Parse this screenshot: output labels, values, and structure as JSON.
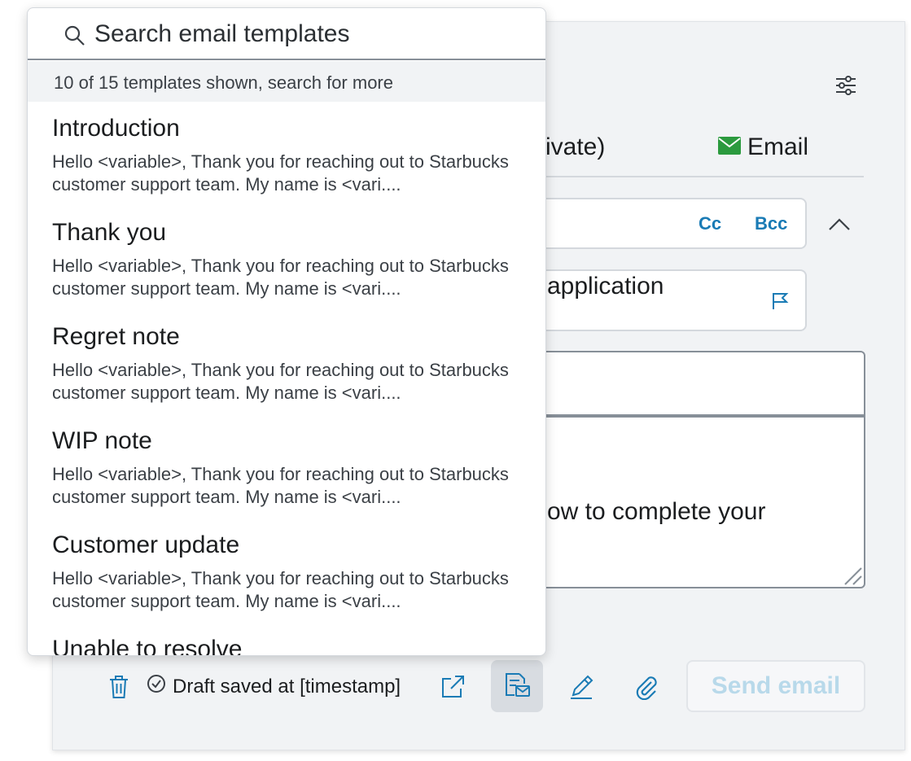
{
  "colors": {
    "accent": "#1a7bb5",
    "email_icon": "#2b9a3e",
    "send_disabled_text": "#b8d9ea"
  },
  "composer": {
    "tabs": {
      "private_fragment": "Private)",
      "email_label": "Email",
      "email_icon": "envelope-icon"
    },
    "recipients": {
      "cc_label": "Cc",
      "bcc_label": "Bcc"
    },
    "subject_fragment": "application",
    "body_fragment": "ow to complete your"
  },
  "footer": {
    "draft_status": "Draft saved at [timestamp]",
    "send_label": "Send email",
    "icons": [
      "trash-icon",
      "check-circle-icon",
      "popout-icon",
      "email-template-icon",
      "signature-icon",
      "paperclip-icon"
    ]
  },
  "template_dropdown": {
    "search_placeholder": "Search email templates",
    "count_text": "10 of 15 templates shown, search for more",
    "templates": [
      {
        "name": "Introduction",
        "preview": "Hello <variable>, Thank you for reaching out to Starbucks customer support team. My name is <vari...."
      },
      {
        "name": "Thank you",
        "preview": "Hello <variable>, Thank you for reaching out to Starbucks customer support team. My name is <vari...."
      },
      {
        "name": "Regret note",
        "preview": "Hello <variable>, Thank you for reaching out to Starbucks customer support team. My name is <vari...."
      },
      {
        "name": "WIP note",
        "preview": "Hello <variable>, Thank you for reaching out to Starbucks customer support team. My name is <vari...."
      },
      {
        "name": "Customer update",
        "preview": "Hello <variable>, Thank you for reaching out to Starbucks customer support team. My name is <vari...."
      },
      {
        "name": "Unable to resolve",
        "preview": ""
      }
    ]
  }
}
